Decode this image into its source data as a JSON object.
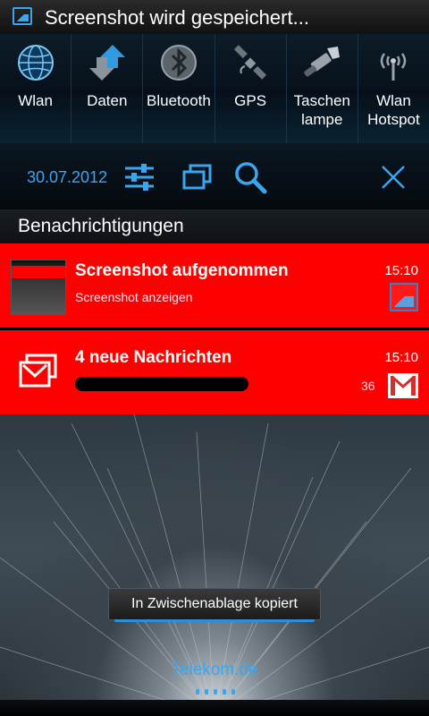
{
  "status_bar": {
    "text": "Screenshot wird gespeichert...",
    "icon": "gallery-icon"
  },
  "toggles": [
    {
      "label": "Wlan",
      "icon": "wifi-globe-icon"
    },
    {
      "label": "Daten",
      "icon": "data-arrows-icon"
    },
    {
      "label": "Bluetooth",
      "icon": "bluetooth-icon"
    },
    {
      "label": "GPS",
      "icon": "satellite-icon"
    },
    {
      "label": "Taschen\nlampe",
      "icon": "flashlight-icon"
    },
    {
      "label": "Wlan\nHotspot",
      "icon": "hotspot-icon"
    }
  ],
  "tools": {
    "date": "30.07.2012",
    "icons": [
      "settings-sliders-icon",
      "windows-icon",
      "search-icon",
      "close-icon"
    ]
  },
  "section": {
    "title": "Benachrichtigungen"
  },
  "notifications": [
    {
      "title": "Screenshot aufgenommen",
      "subtitle": "Screenshot anzeigen",
      "time": "15:10",
      "icon": "gallery-icon"
    },
    {
      "title": "4 neue Nachrichten",
      "time": "15:10",
      "count": "36",
      "icon": "gmail-icon"
    }
  ],
  "toast": {
    "text": "In Zwischenablage kopiert"
  },
  "carrier": "Telekom.de",
  "colors": {
    "accent": "#3aa6f0",
    "notification_bg": "#ff0000"
  }
}
